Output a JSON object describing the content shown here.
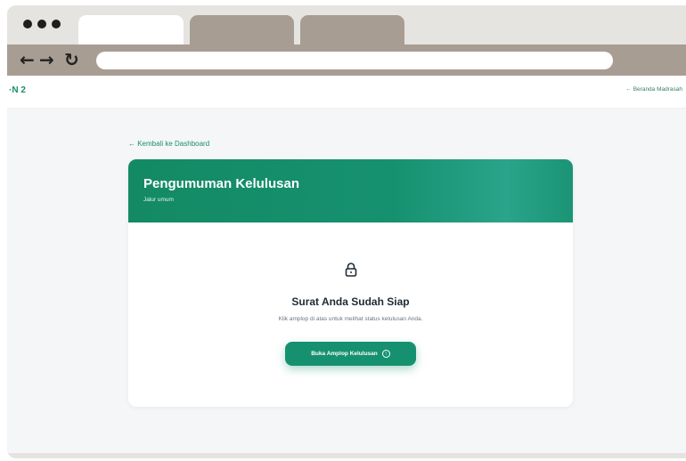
{
  "browser": {
    "back_glyph": "←",
    "forward_glyph": "→",
    "reload_glyph": "↻"
  },
  "header": {
    "brand": "·N 2",
    "top_link": "←  Beranda Madrasah"
  },
  "page": {
    "back_link": "← Kembali ke Dashboard"
  },
  "card": {
    "title": "Pengumuman Kelulusan",
    "subtitle": "Jalur umum",
    "ready_title": "Surat Anda Sudah Siap",
    "ready_description": "Klik amplop di atas untuk melihat status kelulusan Anda.",
    "button_label": "Buka Amplop Kelulusan",
    "button_icon_glyph": "↑"
  },
  "icons": {
    "lock": "lock-icon",
    "button": "arrow-circle-icon"
  },
  "colors": {
    "accent": "#169170",
    "browser_chrome": "#a89d93",
    "page_background": "#f4f6f8"
  }
}
